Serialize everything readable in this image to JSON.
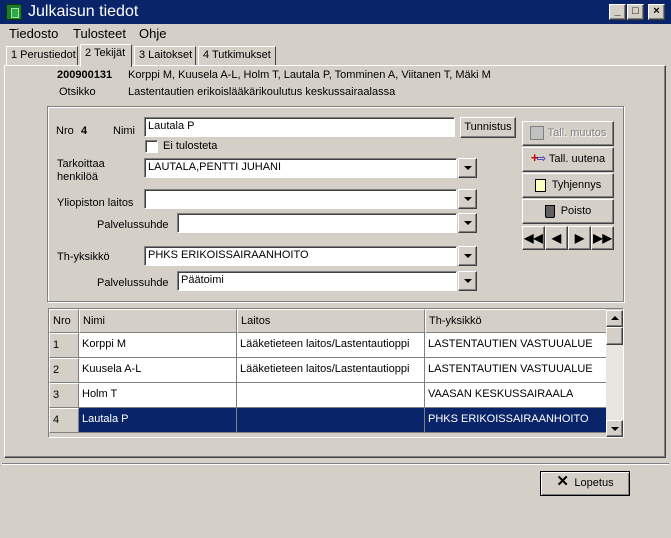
{
  "window": {
    "title": "Julkaisun tiedot",
    "controls": {
      "minimize": "_",
      "maximize": "□",
      "close": "×"
    }
  },
  "menu": [
    "Tiedosto",
    "Tulosteet",
    "Ohje"
  ],
  "tabs": [
    "1 Perustiedot",
    "2 Tekijät",
    "3 Laitokset",
    "4 Tutkimukset"
  ],
  "header": {
    "id": "200900131",
    "authors": "Korppi M, Kuusela A-L, Holm T, Lautala P, Tomminen A, Viitanen T, Mäki M",
    "title_label": "Otsikko",
    "title_value": "Lastentautien erikoislääkärikoulutus keskussairaalassa"
  },
  "form": {
    "nro_label": "Nro",
    "nro_value": "4",
    "nimi_label": "Nimi",
    "nimi_value": "Lautala P",
    "tunnistus_label": "Tunnistus",
    "ei_tulosteta_label": "Ei tulosteta",
    "tarkoittaa_label_1": "Tarkoittaa",
    "tarkoittaa_label_2": "henkilöä",
    "tarkoittaa_value": "LAUTALA,PENTTI JUHANI",
    "yliopiston_label": "Yliopiston laitos",
    "yliopiston_value": "",
    "palvelussuhde1_label": "Palvelussuhde",
    "palvelussuhde1_value": "",
    "th_label": "Th-yksikkö",
    "th_value": "PHKS ERIKOISSAIRAANHOITO",
    "palvelussuhde2_label": "Palvelussuhde",
    "palvelussuhde2_value": "Päätoimi"
  },
  "actions": {
    "tall_muutos": "Tall. muutos",
    "tall_uutena": "Tall. uutena",
    "tyhjennys": "Tyhjennys",
    "poisto": "Poisto",
    "nav_first": "◀◀",
    "nav_prev": "◀",
    "nav_next": "▶",
    "nav_last": "▶▶"
  },
  "grid": {
    "columns": [
      "Nro",
      "Nimi",
      "Laitos",
      "Th-yksikkö"
    ],
    "rows": [
      {
        "nro": "1",
        "nimi": "Korppi M",
        "laitos": "Lääketieteen laitos/Lastentautioppi",
        "th": "LASTENTAUTIEN VASTUUALUE"
      },
      {
        "nro": "2",
        "nimi": "Kuusela A-L",
        "laitos": "Lääketieteen laitos/Lastentautioppi",
        "th": "LASTENTAUTIEN VASTUUALUE"
      },
      {
        "nro": "3",
        "nimi": "Holm T",
        "laitos": "",
        "th": "VAASAN KESKUSSAIRAALA"
      },
      {
        "nro": "4",
        "nimi": "Lautala P",
        "laitos": "",
        "th": "PHKS ERIKOISSAIRAANHOITO"
      }
    ]
  },
  "footer": {
    "lopetus": "Lopetus"
  }
}
